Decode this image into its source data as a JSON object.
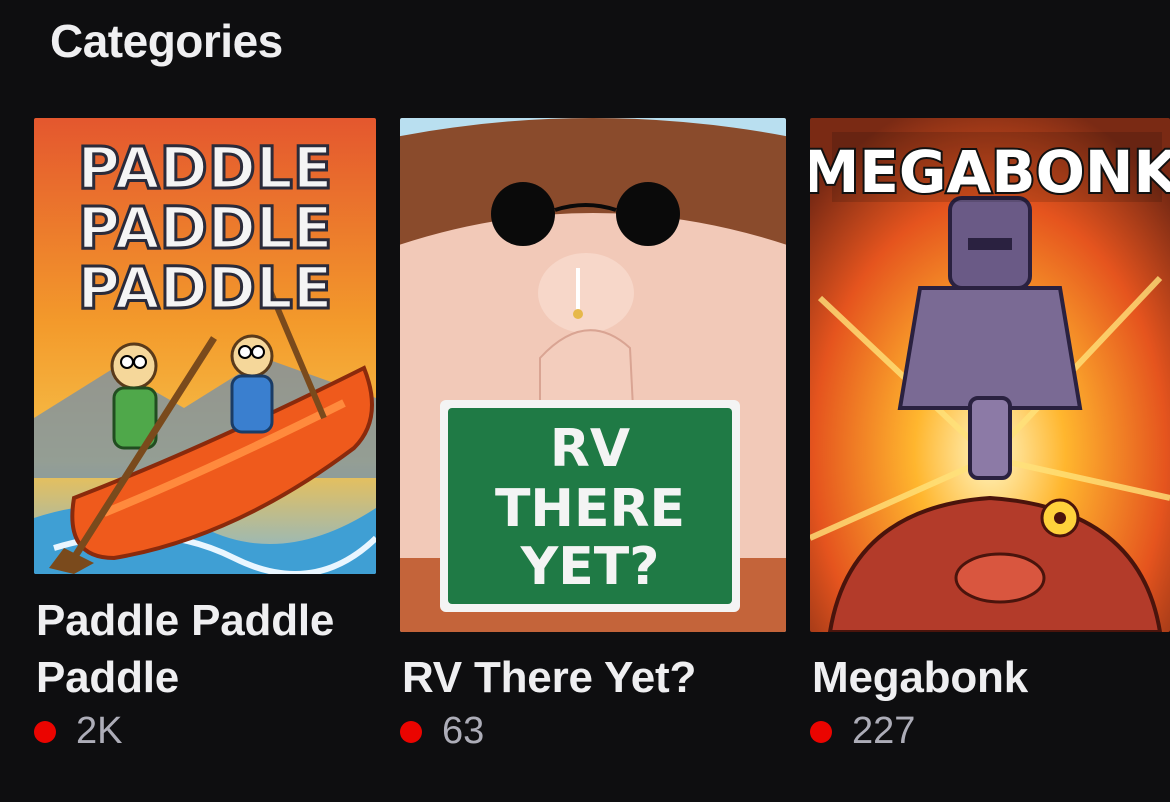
{
  "section": {
    "title": "Categories"
  },
  "categories": [
    {
      "name": "Paddle Paddle Paddle",
      "viewers": "2K",
      "cover_text": [
        "PADDLE",
        "PADDLE",
        "PADDLE"
      ],
      "icon": "live-dot-icon"
    },
    {
      "name": "RV There Yet?",
      "viewers": "63",
      "cover_text": [
        "RV",
        "THERE",
        "YET?"
      ],
      "icon": "live-dot-icon"
    },
    {
      "name": "Megabonk",
      "viewers": "227",
      "cover_text": [
        "MEGABONK"
      ],
      "icon": "live-dot-icon"
    }
  ],
  "colors": {
    "background": "#0e0e10",
    "text": "#efeff1",
    "muted": "#adadb8",
    "live": "#eb0400"
  }
}
